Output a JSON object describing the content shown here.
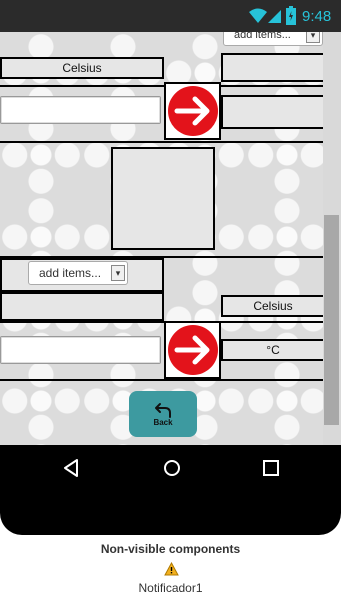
{
  "status_bar": {
    "time": "9:48"
  },
  "app": {
    "top_dropdown": {
      "text": "add items..."
    },
    "row1": {
      "left_label": "Celsius",
      "right_label": "",
      "input_value": "",
      "result_label": ""
    },
    "row2": {
      "dropdown": {
        "text": "add items..."
      },
      "right_label": "Celsius",
      "input_value": "",
      "result_label": "°C"
    },
    "back_button": {
      "label": "Back"
    }
  },
  "designer": {
    "nonvisible_title": "Non-visible components",
    "components": [
      {
        "name": "Notificador1",
        "icon": "warning-icon"
      }
    ]
  },
  "colors": {
    "arrow_red": "#e3131b",
    "back_button": "#3d9aa0",
    "status_bar": "#2b2b2b"
  }
}
